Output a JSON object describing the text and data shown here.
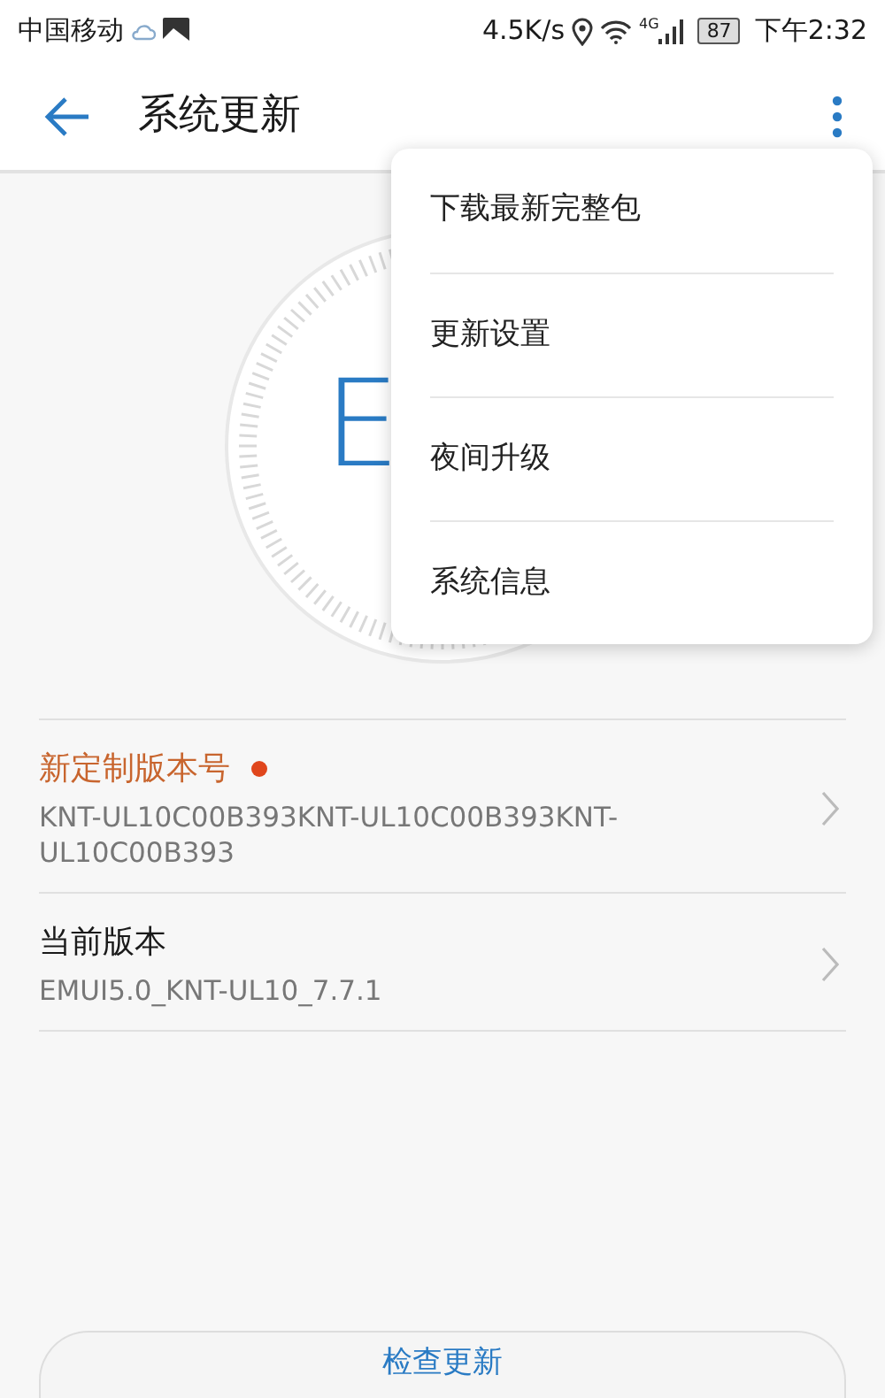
{
  "status_bar": {
    "carrier": "中国移动",
    "speed": "4.5K/s",
    "network": "4G",
    "battery": "87",
    "time": "下午2:32"
  },
  "app_bar": {
    "title": "系统更新"
  },
  "dial": {
    "logo_text": "E"
  },
  "menu": {
    "items": [
      {
        "label": "下载最新完整包"
      },
      {
        "label": "更新设置"
      },
      {
        "label": "夜间升级"
      },
      {
        "label": "系统信息"
      }
    ]
  },
  "versions": [
    {
      "title": "新定制版本号",
      "highlighted": true,
      "color": "#e0461c",
      "value": "KNT-UL10C00B393KNT-UL10C00B393KNT-UL10C00B393"
    },
    {
      "title": "当前版本",
      "highlighted": false,
      "value": "EMUI5.0_KNT-UL10_7.7.1"
    }
  ],
  "check_button": {
    "label": "检查更新"
  }
}
